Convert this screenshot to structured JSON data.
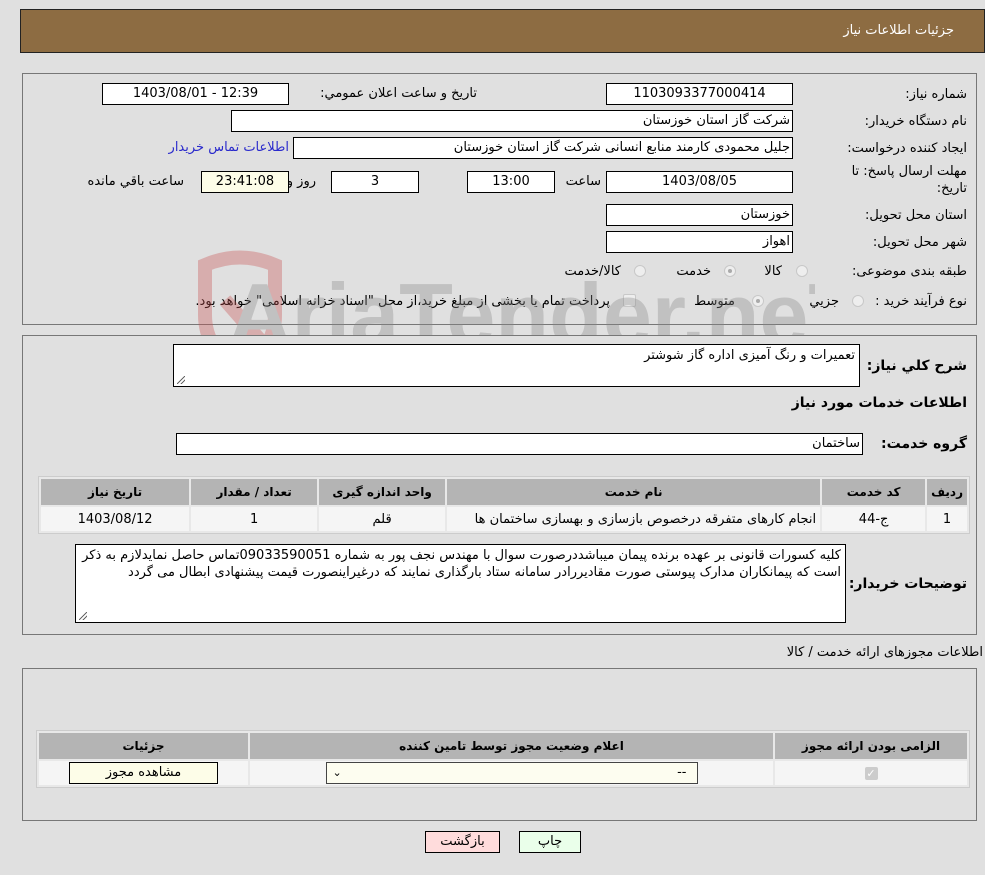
{
  "header": {
    "title": "جزئیات اطلاعات نیاز"
  },
  "form": {
    "need_number": {
      "label": "شماره نیاز:",
      "value": "1103093377000414"
    },
    "announce_datetime": {
      "label": "تاریخ و ساعت اعلان عمومي:",
      "value": "1403/08/01 - 12:39"
    },
    "buyer_org": {
      "label": "نام دستگاه خریدار:",
      "value": "شرکت گاز استان خوزستان"
    },
    "requester": {
      "label": "ایجاد کننده درخواست:",
      "value": "جلیل محمودی کارمند منابع انسانی شرکت گاز استان خوزستان",
      "contact_link": "اطلاعات تماس خریدار"
    },
    "deadline": {
      "label_line1": "مهلت ارسال پاسخ: تا",
      "label_line2": "تاریخ:",
      "date": "1403/08/05",
      "time_label": "ساعت",
      "time": "13:00",
      "days": "3",
      "days_label": "روز و",
      "remaining": "23:41:08",
      "remaining_label": "ساعت باقي مانده"
    },
    "province": {
      "label": "استان محل تحویل:",
      "value": "خوزستان"
    },
    "city": {
      "label": "شهر محل تحویل:",
      "value": "اهواز"
    },
    "category": {
      "label": "طبقه بندی موضوعی:",
      "options": [
        "کالا",
        "خدمت",
        "کالا/خدمت"
      ],
      "selected": "خدمت"
    },
    "purchase_type": {
      "label": "نوع فرآیند خرید :",
      "options": [
        "جزیي",
        "متوسط"
      ],
      "selected": "متوسط",
      "treasury_note": "پرداخت تمام یا بخشی از مبلغ خرید،از محل \"اسناد خزانه اسلامی\" خواهد بود."
    }
  },
  "description": {
    "label": "شرح کلي نیاز:",
    "value": "تعمیرات و رنگ آمیزی اداره گاز شوشتر"
  },
  "services_section": {
    "title": "اطلاعات خدمات مورد نیاز",
    "group_label": "گروه خدمت:",
    "group_value": "ساختمان",
    "table": {
      "headers": [
        "ردیف",
        "کد خدمت",
        "نام خدمت",
        "واحد اندازه گیری",
        "تعداد / مقدار",
        "تاریخ نیاز"
      ],
      "rows": [
        [
          "1",
          "ج-44",
          "انجام کارهای متفرقه درخصوص بازسازی و بهسازی ساختمان ها",
          "قلم",
          "1",
          "1403/08/12"
        ]
      ]
    }
  },
  "buyer_notes": {
    "label": "توضیحات خریدار:",
    "value": "کلیه کسورات قانونی بر عهده برنده پیمان میباشددرصورت سوال با مهندس نجف پور به شماره 09033590051تماس حاصل نمایدلازم به ذکر است که پیمانکاران مدارک پیوستی صورت مقادیررادر سامانه ستاد بارگذاری نمایند که درغیراینصورت قیمت پیشنهادی ابطال می گردد"
  },
  "permits": {
    "title": "اطلاعات مجوزهای ارائه خدمت / کالا",
    "headers": [
      "الزامی بودن ارائه مجوز",
      "اعلام وضعیت مجوز توسط تامین کننده",
      "جزئیات"
    ],
    "row": {
      "required_checked": true,
      "status_value": "--",
      "details_button": "مشاهده مجوز"
    }
  },
  "actions": {
    "print": "چاپ",
    "back": "بازگشت"
  },
  "watermark": {
    "text": "AriaTender.neT"
  },
  "colors": {
    "header_bg": "#8d6c42",
    "link": "#2a2acc",
    "print_bg": "#eaffea",
    "back_bg": "#ffdcdc"
  }
}
